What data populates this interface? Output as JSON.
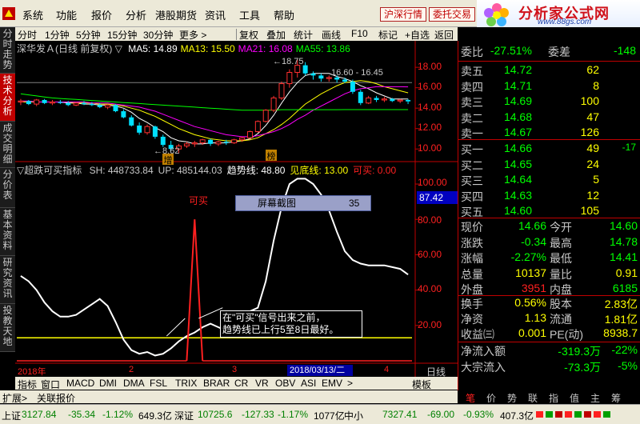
{
  "menu": {
    "items": [
      "系统",
      "功能",
      "报价",
      "分析",
      "港股期货",
      "资讯",
      "工具",
      "帮助"
    ],
    "buttons": [
      "沪深行情",
      "委托交易"
    ]
  },
  "brand": {
    "name": "分析家公式网",
    "url": "www.88gs.com"
  },
  "toolbar": {
    "periods": [
      "分时",
      "1分钟",
      "5分钟",
      "15分钟",
      "30分钟",
      "更多 >"
    ],
    "actions": [
      "复权",
      "叠加",
      "统计",
      "画线",
      "F10",
      "标记",
      "+自选",
      "返回"
    ]
  },
  "side_tabs": [
    "分时走势",
    "技术分析",
    "成交明细",
    "分价表",
    "基本资料",
    "研究资讯",
    "投教天地"
  ],
  "price_chart": {
    "title": "深华发Ａ(日线 前复权)",
    "ma": [
      {
        "label": "MA5: 14.89",
        "color": "#ffffff"
      },
      {
        "label": "MA13: 15.50",
        "color": "#ffff00"
      },
      {
        "label": "MA21: 16.08",
        "color": "#ff00ff"
      },
      {
        "label": "MA55: 13.86",
        "color": "#00ff00"
      }
    ],
    "y_ticks": [
      "18.00",
      "16.00",
      "14.00",
      "12.00",
      "10.00"
    ],
    "annotations": {
      "high": "18.75",
      "range": "16.60 - 16.45",
      "low": "8.62",
      "mark_up": "增",
      "mark_hot": "榜"
    }
  },
  "indicator_chart": {
    "title": "超跌可买指标",
    "params": [
      {
        "label": "SH: 448733.84",
        "color": "#c8c8c8"
      },
      {
        "label": "UP: 485144.03",
        "color": "#c8c8c8"
      },
      {
        "label": "趋势线: 48.80",
        "color": "#ffffff"
      },
      {
        "label": "见底线: 13.00",
        "color": "#ffff00"
      },
      {
        "label": "可买: 0.00",
        "color": "#ff2020"
      }
    ],
    "y_ticks": [
      "100.00",
      "80.00",
      "60.00",
      "40.00",
      "20.00"
    ],
    "current_value": "87.42",
    "signal_label": "可买",
    "hint_lines": [
      "在\"可买\"信号出来之前，",
      "趋势线已上行5至8日最好。"
    ],
    "screenshot_popup": {
      "title": "屏幕截图",
      "number": "35"
    }
  },
  "x_axis": {
    "year": "2018年",
    "months": [
      "2",
      "3",
      "4"
    ],
    "cursor_date": "2018/03/13/二",
    "period_label": "日线"
  },
  "indicator_bar": [
    "指标",
    "窗口",
    "MACD",
    "DMI",
    "DMA",
    "FSL",
    "TRIX",
    "BRAR",
    "CR",
    "VR",
    "OBV",
    "ASI",
    "EMV",
    ">"
  ],
  "indicator_bar_right": "模板",
  "bottom_bar": [
    "扩展>",
    "关联报价"
  ],
  "quote": {
    "wei_bi": {
      "label": "委比",
      "value": "-27.51%",
      "label2": "委差",
      "value2": "-148"
    },
    "sells": [
      {
        "label": "卖五",
        "price": "14.72",
        "vol": "62"
      },
      {
        "label": "卖四",
        "price": "14.71",
        "vol": "8"
      },
      {
        "label": "卖三",
        "price": "14.69",
        "vol": "100"
      },
      {
        "label": "卖二",
        "price": "14.68",
        "vol": "47"
      },
      {
        "label": "卖一",
        "price": "14.67",
        "vol": "126"
      }
    ],
    "buys": [
      {
        "label": "买一",
        "price": "14.66",
        "vol": "49",
        "chg": "-17"
      },
      {
        "label": "买二",
        "price": "14.65",
        "vol": "24",
        "chg": ""
      },
      {
        "label": "买三",
        "price": "14.64",
        "vol": "5",
        "chg": ""
      },
      {
        "label": "买四",
        "price": "14.63",
        "vol": "12",
        "chg": ""
      },
      {
        "label": "买五",
        "price": "14.60",
        "vol": "105",
        "chg": ""
      }
    ],
    "stats1": [
      {
        "l1": "现价",
        "v1": "14.66",
        "c1": "#00ff00",
        "l2": "今开",
        "v2": "14.60",
        "c2": "#00ff00"
      },
      {
        "l1": "涨跌",
        "v1": "-0.34",
        "c1": "#00ff00",
        "l2": "最高",
        "v2": "14.78",
        "c2": "#00ff00"
      },
      {
        "l1": "涨幅",
        "v1": "-2.27%",
        "c1": "#00ff00",
        "l2": "最低",
        "v2": "14.41",
        "c2": "#00ff00"
      },
      {
        "l1": "总量",
        "v1": "10137",
        "c1": "#ffff00",
        "l2": "量比",
        "v2": "0.91",
        "c2": "#ffff00"
      },
      {
        "l1": "外盘",
        "v1": "3951",
        "c1": "#ff2020",
        "l2": "内盘",
        "v2": "6185",
        "c2": "#00ff00"
      }
    ],
    "stats2": [
      {
        "l1": "换手",
        "v1": "0.56%",
        "c1": "#ffff00",
        "l2": "股本",
        "v2": "2.83亿",
        "c2": "#ffff00"
      },
      {
        "l1": "净资",
        "v1": "1.13",
        "c1": "#ffff00",
        "l2": "流通",
        "v2": "1.81亿",
        "c2": "#ffff00"
      },
      {
        "l1": "收益㈢",
        "v1": "0.001",
        "c1": "#ffff00",
        "l2": "PE(动)",
        "v2": "8938.7",
        "c2": "#ffff00"
      }
    ],
    "flows": [
      {
        "label": "净流入额",
        "v1": "-319.3万",
        "v2": "-22%"
      },
      {
        "label": "大宗流入",
        "v1": "-73.3万",
        "v2": "-5%"
      }
    ],
    "tabs": [
      "笔",
      "价",
      "势",
      "联",
      "指",
      "值",
      "主",
      "筹"
    ]
  },
  "status_bar": [
    {
      "text": "上证",
      "color": "#000000"
    },
    {
      "text": "3127.84",
      "color": "#008000"
    },
    {
      "text": "-35.34",
      "color": "#008000"
    },
    {
      "text": "-1.12%",
      "color": "#008000"
    },
    {
      "text": "649.3亿",
      "color": "#000000"
    },
    {
      "text": "深证",
      "color": "#000000"
    },
    {
      "text": "10725.6",
      "color": "#008000"
    },
    {
      "text": "-127.33",
      "color": "#008000"
    },
    {
      "text": "-1.17%",
      "color": "#008000"
    },
    {
      "text": "1077亿",
      "color": "#000000"
    },
    {
      "text": "中小",
      "color": "#000000"
    },
    {
      "text": "7327.41",
      "color": "#008000"
    },
    {
      "text": "-69.00",
      "color": "#008000"
    },
    {
      "text": "-0.93%",
      "color": "#008000"
    },
    {
      "text": "407.3亿",
      "color": "#000000"
    }
  ],
  "chart_data": [
    {
      "type": "candlestick",
      "name": "深华发Ａ",
      "ylim": [
        9.0,
        19.5
      ],
      "y_ticks": [
        10,
        12,
        14,
        16,
        18
      ],
      "candles": [
        [
          14.6,
          14.9,
          14.3,
          14.7
        ],
        [
          14.7,
          14.8,
          14.3,
          14.4
        ],
        [
          14.4,
          14.9,
          14.2,
          14.8
        ],
        [
          14.8,
          14.9,
          14.4,
          14.5
        ],
        [
          14.5,
          14.8,
          14.3,
          14.6
        ],
        [
          14.6,
          14.8,
          14.4,
          14.5
        ],
        [
          14.5,
          14.7,
          14.2,
          14.3
        ],
        [
          14.3,
          14.6,
          14.2,
          14.5
        ],
        [
          14.5,
          14.7,
          14.3,
          14.4
        ],
        [
          14.4,
          14.6,
          14.2,
          14.3
        ],
        [
          14.3,
          14.5,
          14.0,
          14.1
        ],
        [
          14.1,
          14.4,
          13.9,
          14.3
        ],
        [
          14.3,
          14.4,
          13.6,
          13.7
        ],
        [
          13.7,
          13.9,
          13.0,
          13.1
        ],
        [
          13.1,
          13.3,
          12.2,
          12.3
        ],
        [
          12.3,
          12.6,
          11.4,
          11.6
        ],
        [
          11.6,
          12.4,
          11.4,
          12.2
        ],
        [
          12.2,
          12.3,
          11.0,
          11.2
        ],
        [
          11.2,
          11.4,
          10.2,
          10.4
        ],
        [
          10.4,
          10.8,
          9.8,
          10.0
        ],
        [
          10.0,
          10.5,
          9.6,
          10.3
        ],
        [
          10.3,
          10.7,
          10.1,
          10.5
        ],
        [
          10.5,
          10.8,
          10.2,
          10.6
        ],
        [
          10.6,
          11.0,
          10.4,
          10.9
        ],
        [
          10.9,
          11.0,
          10.3,
          10.5
        ],
        [
          10.5,
          10.8,
          10.3,
          10.7
        ],
        [
          10.7,
          10.9,
          10.4,
          10.6
        ],
        [
          10.6,
          11.0,
          10.5,
          10.9
        ],
        [
          10.9,
          11.2,
          10.7,
          11.1
        ],
        [
          11.1,
          11.8,
          11.0,
          11.7
        ],
        [
          11.7,
          12.8,
          11.6,
          12.7
        ],
        [
          12.7,
          13.9,
          12.6,
          13.8
        ],
        [
          13.8,
          15.2,
          13.6,
          15.0
        ],
        [
          15.0,
          16.6,
          14.8,
          16.4
        ],
        [
          16.4,
          17.8,
          16.0,
          17.5
        ],
        [
          17.5,
          18.75,
          17.0,
          18.2
        ],
        [
          18.2,
          18.5,
          17.2,
          17.4
        ],
        [
          17.4,
          17.6,
          16.8,
          17.2
        ],
        [
          17.2,
          17.4,
          16.6,
          16.9
        ],
        [
          16.9,
          17.2,
          16.6,
          17.0
        ],
        [
          17.0,
          17.2,
          16.5,
          16.8
        ],
        [
          16.8,
          17.0,
          16.45,
          16.6
        ],
        [
          16.6,
          16.8,
          15.4,
          15.6
        ],
        [
          15.6,
          15.8,
          14.3,
          14.5
        ],
        [
          14.5,
          15.2,
          14.4,
          15.0
        ],
        [
          15.0,
          15.2,
          14.6,
          14.8
        ],
        [
          14.8,
          15.1,
          14.6,
          14.9
        ],
        [
          14.9,
          15.0,
          14.6,
          14.7
        ],
        [
          14.7,
          14.9,
          14.5,
          14.8
        ],
        [
          14.8,
          14.9,
          14.4,
          14.66
        ]
      ],
      "ma_series": [
        {
          "name": "MA5",
          "color": "#ffffff",
          "values": [
            14.6,
            14.6,
            14.6,
            14.6,
            14.6,
            14.6,
            14.5,
            14.5,
            14.4,
            14.4,
            14.3,
            14.3,
            14.2,
            14.0,
            13.6,
            13.0,
            12.6,
            12.1,
            11.7,
            11.1,
            10.8,
            10.7,
            10.5,
            10.5,
            10.6,
            10.6,
            10.6,
            10.7,
            10.8,
            11.0,
            11.5,
            12.3,
            13.3,
            14.5,
            15.6,
            16.5,
            17.2,
            17.4,
            17.4,
            17.4,
            17.1,
            16.9,
            16.6,
            16.2,
            15.9,
            15.5,
            15.2,
            14.9,
            14.9,
            14.89
          ]
        },
        {
          "name": "MA13",
          "color": "#ffff00",
          "values": [
            14.6,
            14.6,
            14.6,
            14.6,
            14.6,
            14.6,
            14.6,
            14.5,
            14.5,
            14.5,
            14.4,
            14.4,
            14.3,
            14.2,
            14.0,
            13.8,
            13.5,
            13.2,
            12.8,
            12.4,
            12.0,
            11.7,
            11.4,
            11.2,
            11.0,
            10.9,
            10.8,
            10.8,
            10.8,
            10.9,
            11.1,
            11.5,
            11.9,
            12.4,
            13.0,
            13.7,
            14.4,
            14.9,
            15.4,
            15.8,
            16.2,
            16.5,
            16.6,
            16.7,
            16.6,
            16.4,
            16.1,
            15.9,
            15.7,
            15.5
          ]
        },
        {
          "name": "MA21",
          "color": "#ff00ff",
          "values": [
            14.7,
            14.7,
            14.6,
            14.6,
            14.6,
            14.6,
            14.6,
            14.6,
            14.6,
            14.5,
            14.5,
            14.5,
            14.4,
            14.3,
            14.2,
            14.1,
            13.9,
            13.7,
            13.4,
            13.1,
            12.8,
            12.5,
            12.2,
            12.0,
            11.8,
            11.6,
            11.4,
            11.3,
            11.2,
            11.2,
            11.3,
            11.5,
            11.7,
            12.0,
            12.4,
            12.9,
            13.3,
            13.8,
            14.2,
            14.6,
            15.0,
            15.4,
            15.7,
            15.9,
            16.0,
            16.1,
            16.1,
            16.1,
            16.1,
            16.08
          ]
        },
        {
          "name": "MA55",
          "color": "#00ff00",
          "values": [
            15.4,
            15.3,
            15.2,
            15.1,
            15.0,
            14.95,
            14.9,
            14.85,
            14.8,
            14.75,
            14.7,
            14.65,
            14.6,
            14.55,
            14.5,
            14.45,
            14.4,
            14.35,
            14.3,
            14.25,
            14.2,
            14.15,
            14.1,
            14.05,
            14.0,
            13.95,
            13.9,
            13.85,
            13.8,
            13.8,
            13.8,
            13.8,
            13.8,
            13.85,
            13.85,
            13.85,
            13.85,
            13.85,
            13.85,
            13.85,
            13.85,
            13.86,
            13.86,
            13.86,
            13.86,
            13.86,
            13.86,
            13.86,
            13.86,
            13.86
          ]
        }
      ]
    },
    {
      "type": "line",
      "name": "超跌可买指标",
      "ylim": [
        0,
        105
      ],
      "y_ticks": [
        20,
        40,
        60,
        80,
        100
      ],
      "series": [
        {
          "name": "趋势线",
          "color": "#ffffff",
          "values": [
            48,
            45,
            40,
            33,
            28,
            25,
            25,
            26,
            29,
            32,
            35,
            31,
            22,
            12,
            6,
            4,
            5,
            3,
            4,
            7,
            11,
            14,
            16,
            19,
            21,
            19,
            17,
            18,
            22,
            28,
            30,
            45,
            68,
            87,
            100,
            103,
            103,
            100,
            94,
            85,
            73,
            62,
            57,
            55,
            54,
            54,
            54,
            53,
            52,
            48.8
          ]
        },
        {
          "name": "见底线",
          "color": "#ffff00",
          "values": [
            13,
            13,
            13,
            13,
            13,
            13,
            13,
            13,
            13,
            13,
            13,
            13,
            13,
            13,
            13,
            13,
            13,
            13,
            13,
            13,
            13,
            13,
            13,
            13,
            13,
            13,
            13,
            13,
            13,
            13,
            13,
            13,
            13,
            13,
            13,
            13,
            13,
            13,
            13,
            13,
            13,
            13,
            13,
            13,
            13,
            13,
            13,
            13,
            13,
            13
          ]
        },
        {
          "name": "可买",
          "color": "#ff2020",
          "values": [
            0,
            0,
            0,
            0,
            0,
            0,
            0,
            0,
            0,
            0,
            0,
            0,
            0,
            0,
            0,
            0,
            0,
            0,
            0,
            0,
            0,
            0,
            0,
            0,
            0,
            0,
            0,
            0,
            0,
            0,
            0,
            0,
            0,
            0,
            0,
            0,
            0,
            0,
            0,
            0,
            0,
            0,
            0,
            0,
            0,
            0,
            0,
            0,
            0,
            0
          ],
          "signal_index": 22,
          "signal_value": 80
        }
      ]
    }
  ]
}
